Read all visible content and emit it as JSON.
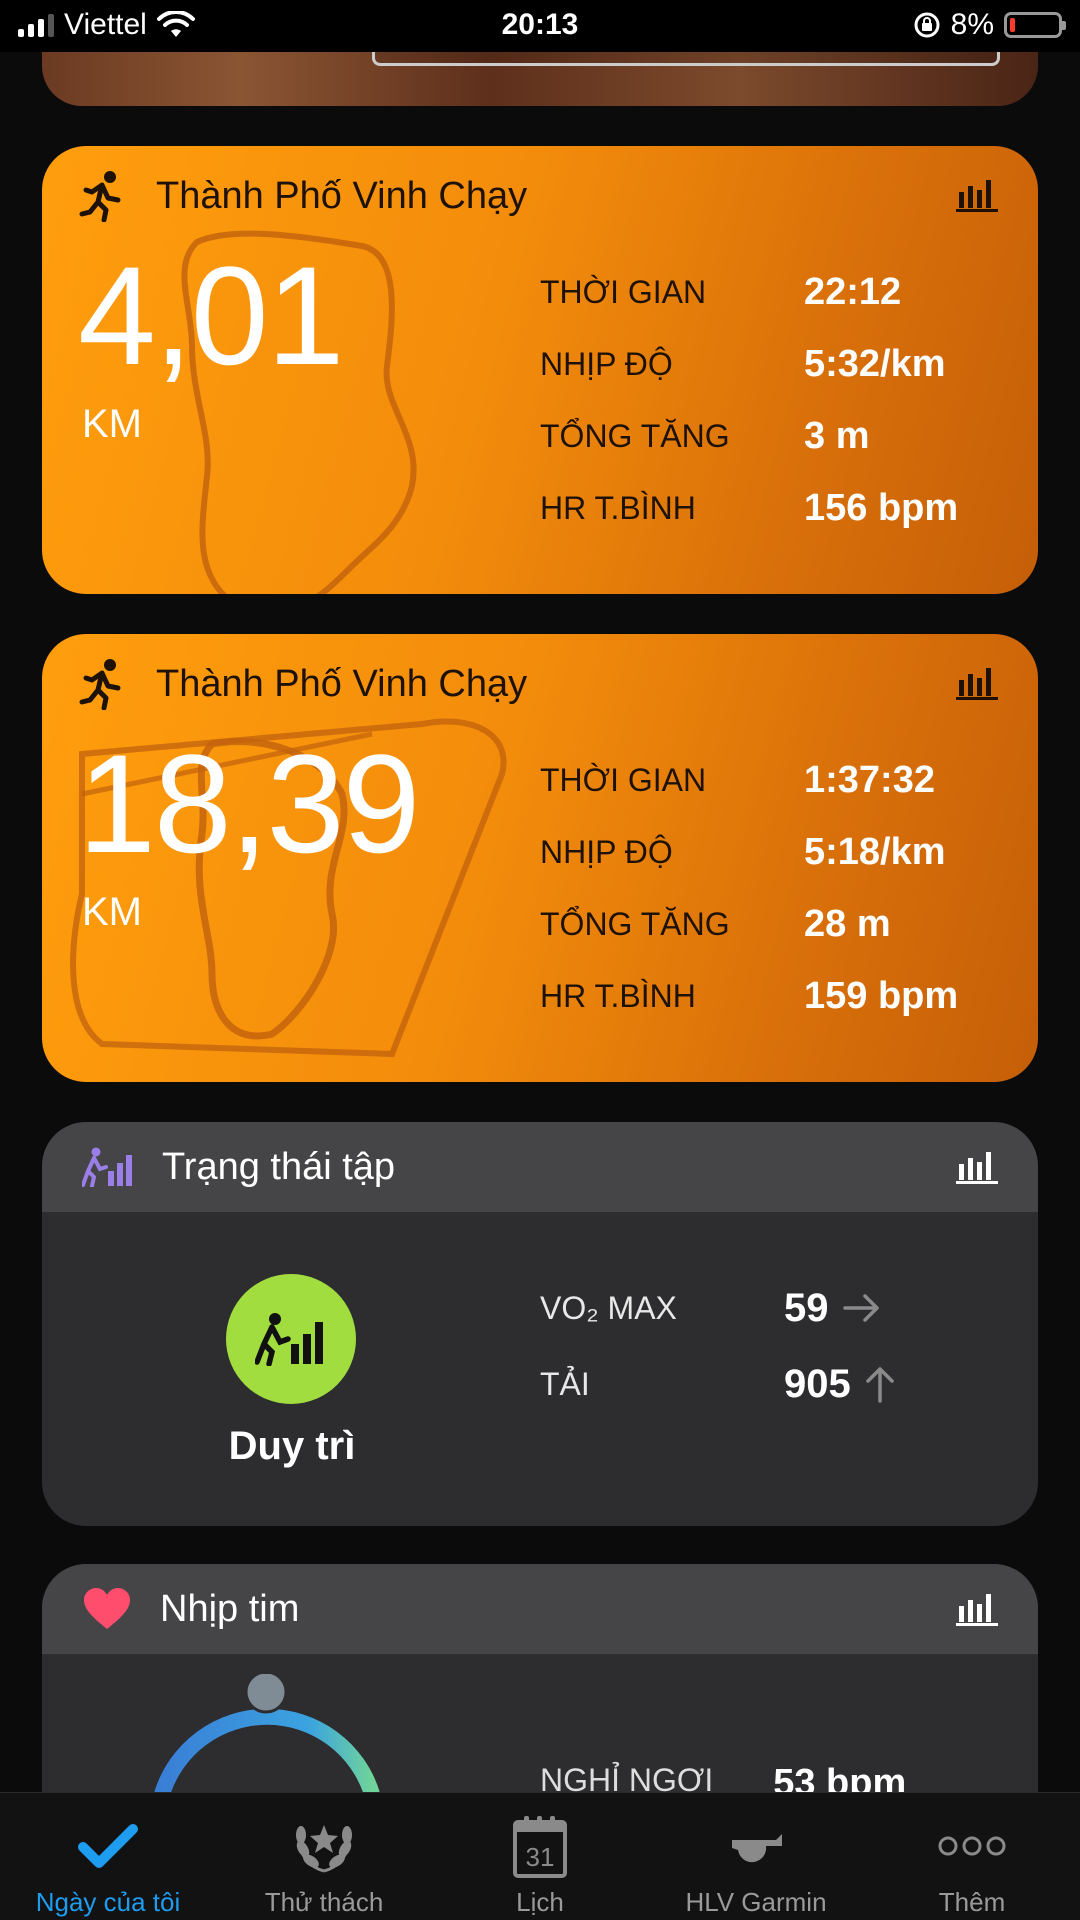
{
  "status_bar": {
    "carrier": "Viettel",
    "time": "20:13",
    "battery_percent": "8%"
  },
  "activities": [
    {
      "title": "Thành Phố Vinh Chạy",
      "distance": "4,01",
      "unit": "KM",
      "stats": [
        {
          "label": "THỜI GIAN",
          "value": "22:12"
        },
        {
          "label": "NHỊP ĐỘ",
          "value": "5:32/km"
        },
        {
          "label": "TỔNG TĂNG",
          "value": "3 m"
        },
        {
          "label": "HR T.BÌNH",
          "value": "156 bpm"
        }
      ]
    },
    {
      "title": "Thành Phố Vinh Chạy",
      "distance": "18,39",
      "unit": "KM",
      "stats": [
        {
          "label": "THỜI GIAN",
          "value": "1:37:32"
        },
        {
          "label": "NHỊP ĐỘ",
          "value": "5:18/km"
        },
        {
          "label": "TỔNG TĂNG",
          "value": "28 m"
        },
        {
          "label": "HR T.BÌNH",
          "value": "159 bpm"
        }
      ]
    }
  ],
  "training_status": {
    "title": "Trạng thái tập",
    "status": "Duy trì",
    "status_color": "#a2dd3f",
    "metrics": [
      {
        "label": "VO₂ MAX",
        "value": "59",
        "trend_icon": "arrow-right-icon"
      },
      {
        "label": "TẢI",
        "value": "905",
        "trend_icon": "arrow-up-icon"
      }
    ]
  },
  "heart_rate": {
    "title": "Nhịp tim",
    "resting_label": "NGHỈ NGƠI",
    "resting_value": "53 bpm"
  },
  "tab_bar": {
    "tabs": [
      {
        "label": "Ngày của tôi",
        "icon": "checkmark-icon",
        "active": true
      },
      {
        "label": "Thử thách",
        "icon": "laurel-icon",
        "active": false
      },
      {
        "label": "Lịch",
        "icon": "calendar-icon",
        "active": false
      },
      {
        "label": "HLV Garmin",
        "icon": "whistle-icon",
        "active": false
      },
      {
        "label": "Thêm",
        "icon": "more-icon",
        "active": false
      }
    ],
    "calendar_day": "31"
  },
  "colors": {
    "accent_blue": "#1e9cf0",
    "activity_orange": "#f38c0b",
    "heart_pink": "#ff4d6d"
  }
}
